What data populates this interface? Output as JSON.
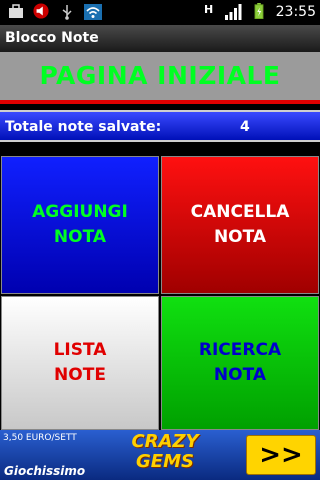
{
  "status_bar": {
    "time": "23:55",
    "network_label": "H"
  },
  "app": {
    "title": "Blocco Note"
  },
  "header": {
    "title": "PAGINA INIZIALE"
  },
  "summary": {
    "label": "Totale note salvate:",
    "count": "4"
  },
  "buttons": {
    "add": {
      "line1": "AGGIUNGI",
      "line2": "NOTA",
      "color": "#00ff22"
    },
    "delete": {
      "line1": "CANCELLA",
      "line2": "NOTA",
      "color": "#ffffff"
    },
    "list": {
      "line1": "LISTA",
      "line2": "NOTE",
      "color": "#e00000"
    },
    "search": {
      "line1": "RICERCA",
      "line2": "NOTA",
      "color": "#0000cc"
    }
  },
  "ad": {
    "price": "3,50 EURO/SETT",
    "brand": "Giochissimo",
    "game_line1": "CRAZY",
    "game_line2": "GEMS",
    "go_label": ">>"
  }
}
